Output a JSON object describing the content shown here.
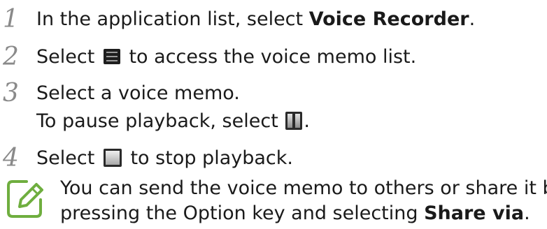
{
  "steps": [
    {
      "number": "1",
      "text_before": "In the application list, select ",
      "bold": "Voice Recorder",
      "text_after": "."
    },
    {
      "number": "2",
      "text_before": "Select ",
      "icon": "menu-list-icon",
      "text_after": " to access the voice memo list."
    },
    {
      "number": "3",
      "line1": "Select a voice memo.",
      "line2_before": "To pause playback, select ",
      "icon": "pause-icon",
      "line2_after": "."
    },
    {
      "number": "4",
      "text_before": "Select ",
      "icon": "stop-icon",
      "text_after": " to stop playback."
    }
  ],
  "note": {
    "icon": "note-pencil-icon",
    "line1": "You can send the voice memo to others or share it by",
    "line2_before": "pressing the Option key and selecting ",
    "line2_bold": "Share via",
    "line2_after": "."
  },
  "colors": {
    "text": "#1a1a1a",
    "step_number": "#8a8a8a",
    "note_icon": "#6fae3f"
  }
}
